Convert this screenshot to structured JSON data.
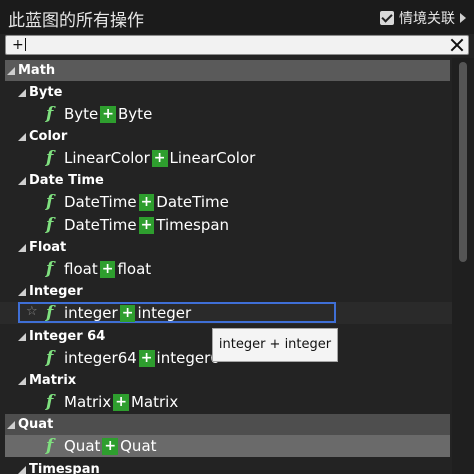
{
  "header": {
    "title": "此蓝图的所有操作",
    "context_label": "情境关联",
    "context_checked": true
  },
  "search": {
    "value": "+"
  },
  "list": {
    "cat_math": "Math",
    "cat_byte": "Byte",
    "byte_l": "Byte",
    "byte_op": "+",
    "byte_r": "Byte",
    "cat_color": "Color",
    "color_l": "LinearColor",
    "color_op": "+",
    "color_r": "LinearColor",
    "cat_datetime": "Date Time",
    "dt1_l": "DateTime",
    "dt1_op": "+",
    "dt1_r": "DateTime",
    "dt2_l": "DateTime",
    "dt2_op": "+",
    "dt2_r": "Timespan",
    "cat_float": "Float",
    "float_l": "float",
    "float_op": "+",
    "float_r": "float",
    "cat_integer": "Integer",
    "int_l": "integer",
    "int_op": "+",
    "int_r": "integer",
    "cat_integer64": "Integer 64",
    "int64_l": "integer64",
    "int64_op": "+",
    "int64_r": "integer6",
    "cat_matrix": "Matrix",
    "matrix_l": "Matrix",
    "matrix_op": "+",
    "matrix_r": "Matrix",
    "cat_quat": "Quat",
    "quat_l": "Quat",
    "quat_op": "+",
    "quat_r": "Quat",
    "cat_timespan": "Timespan"
  },
  "tooltip": {
    "text": "integer + integer"
  },
  "icons": {
    "function": "function-icon",
    "favorite": "star-icon",
    "expand": "chevron-down-icon",
    "clear": "close-icon"
  },
  "colors": {
    "accent_green": "#2e9e2e",
    "selection_blue": "#3f6fd6",
    "function_icon": "#7fe07f"
  }
}
